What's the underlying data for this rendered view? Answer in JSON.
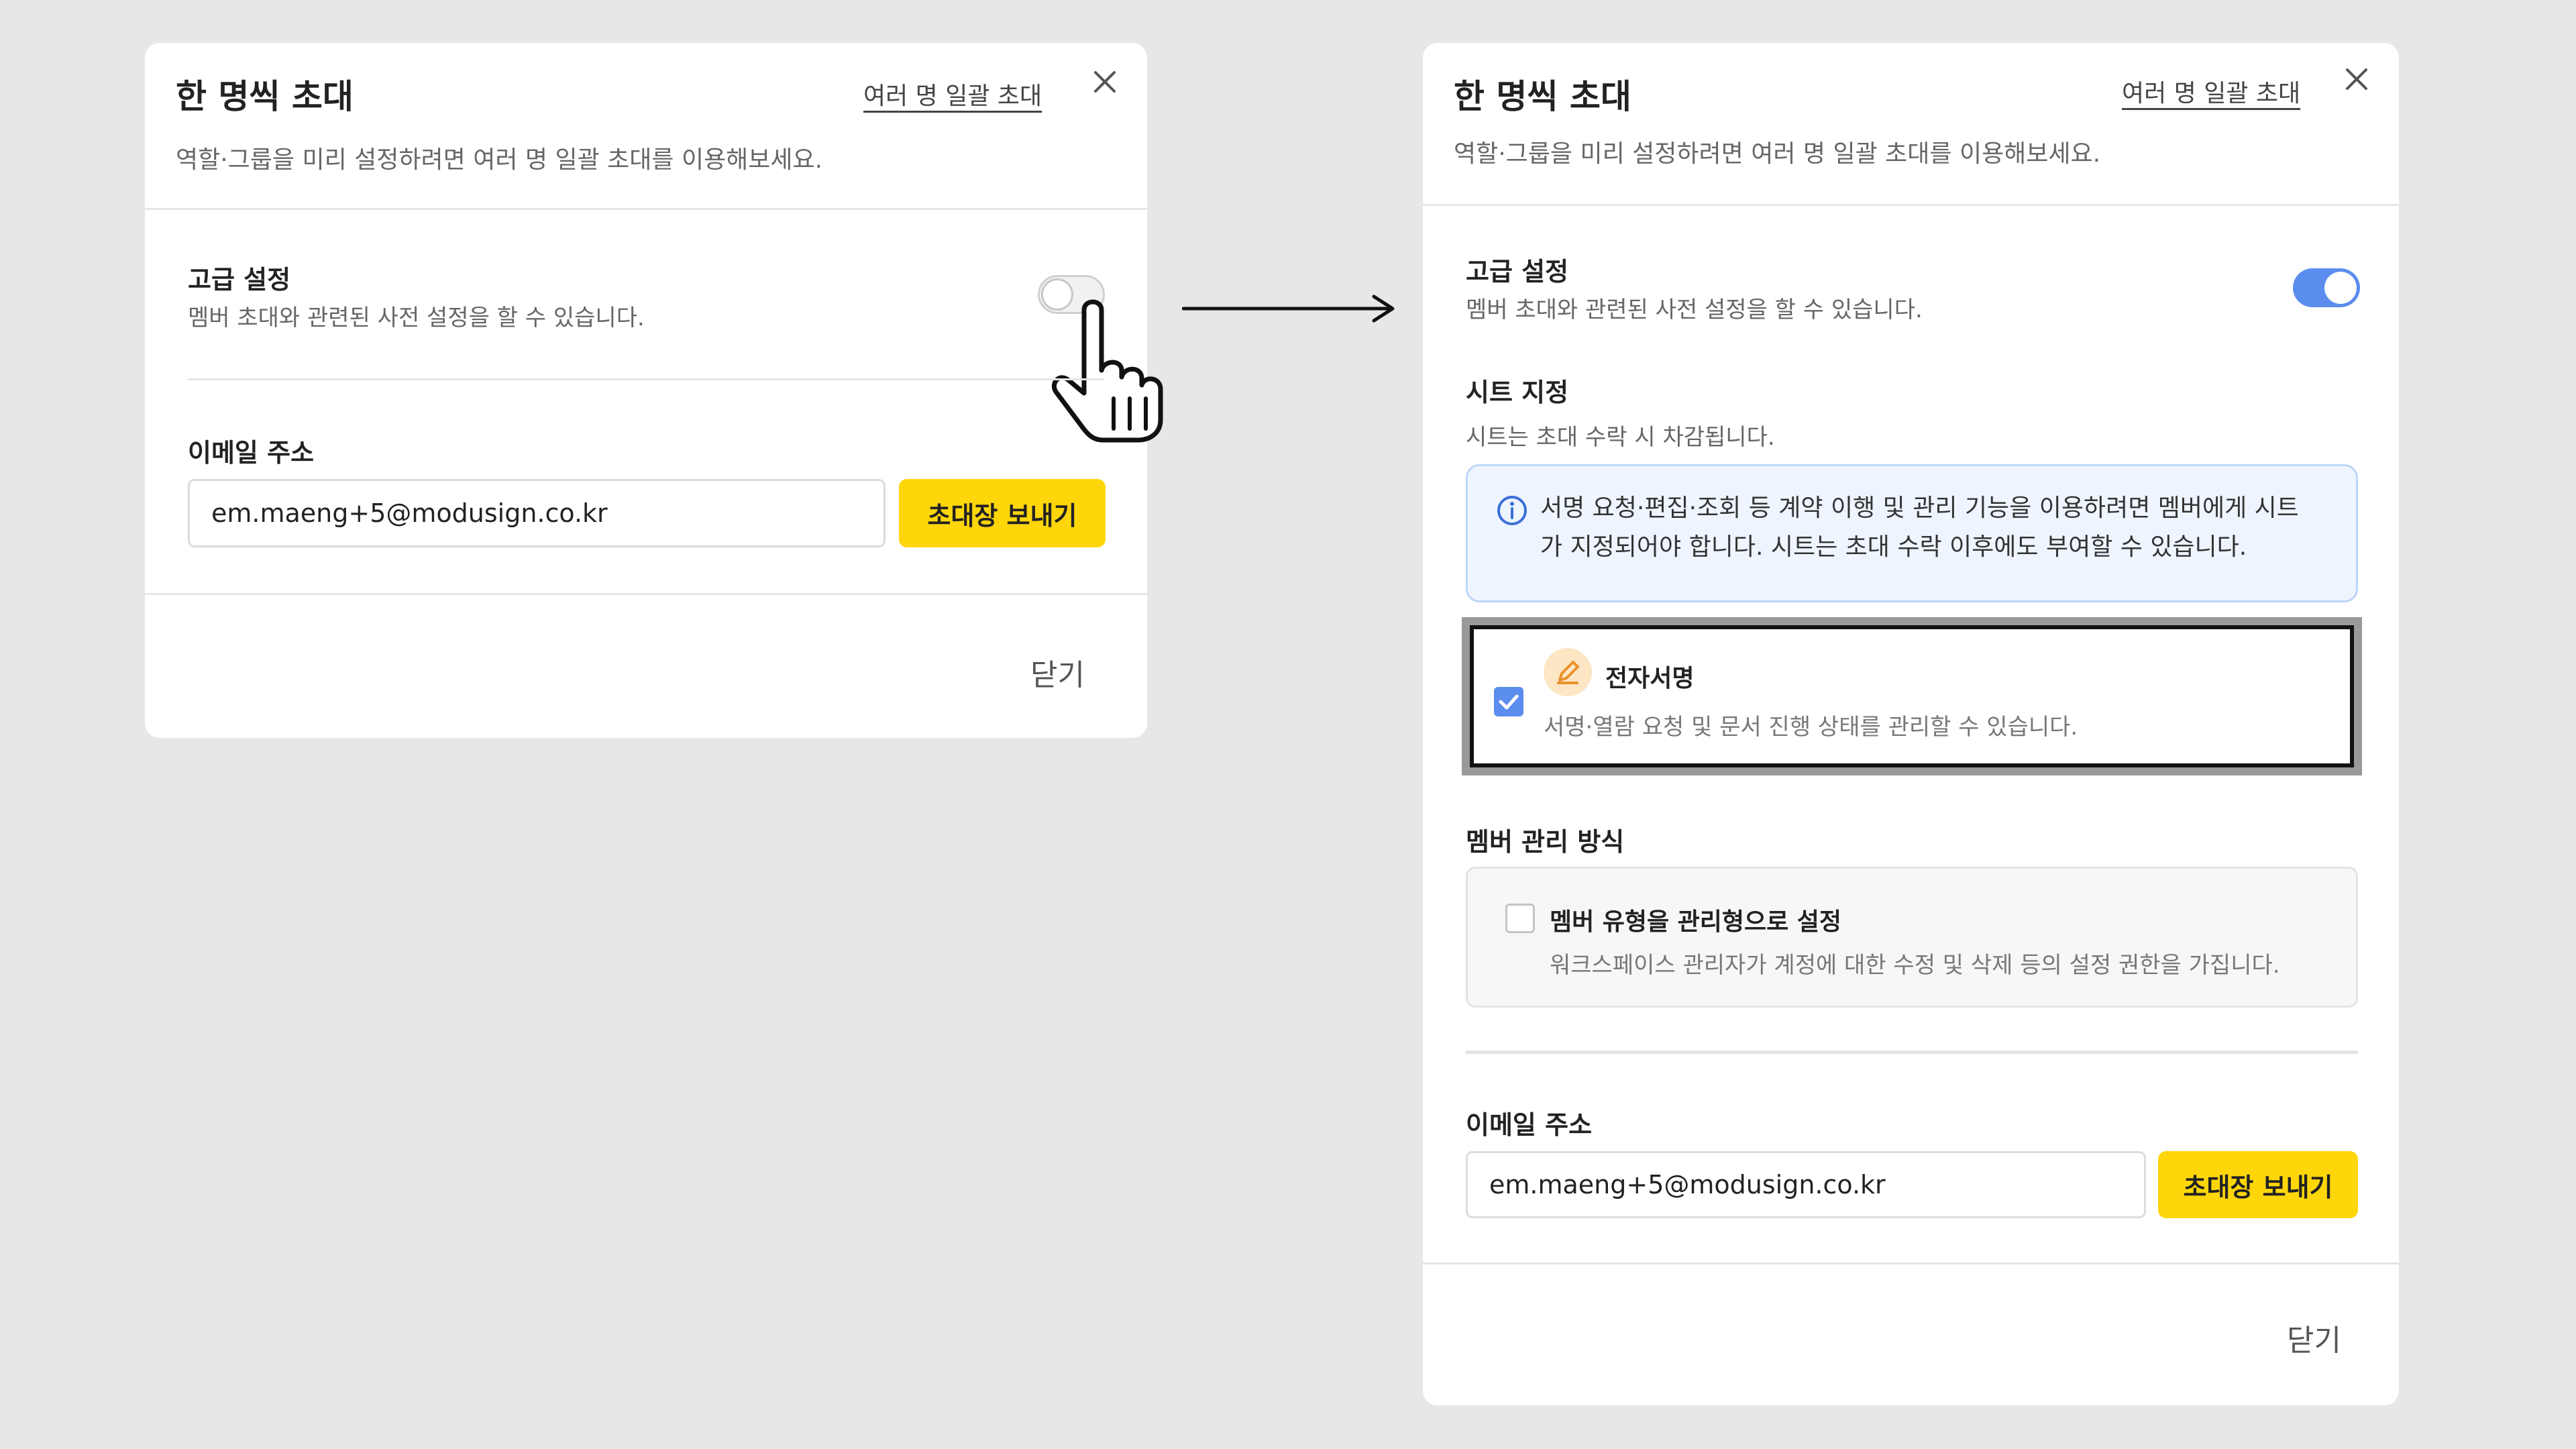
{
  "left_dialog": {
    "title": "한 명씩 초대",
    "bulk_invite_link": "여러 명 일괄 초대",
    "subtitle": "역할·그룹을 미리 설정하려면 여러 명 일괄 초대를 이용해보세요.",
    "advanced": {
      "label": "고급 설정",
      "description": "멤버 초대와 관련된 사전 설정을 할 수 있습니다.",
      "toggle_on": false
    },
    "email": {
      "label": "이메일 주소",
      "value": "em.maeng+5@modusign.co.kr"
    },
    "send_button": "초대장 보내기",
    "close_button": "닫기"
  },
  "right_dialog": {
    "title": "한 명씩 초대",
    "bulk_invite_link": "여러 명 일괄 초대",
    "subtitle": "역할·그룹을 미리 설정하려면 여러 명 일괄 초대를 이용해보세요.",
    "advanced": {
      "label": "고급 설정",
      "description": "멤버 초대와 관련된 사전 설정을 할 수 있습니다.",
      "toggle_on": true
    },
    "seat": {
      "label": "시트 지정",
      "description": "시트는 초대 수락 시 차감됩니다.",
      "info_line1": "서명 요청·편집·조회 등 계약 이행 및 관리 기능을 이용하려면 멤버에게 시트",
      "info_line2": "가 지정되어야 합니다. 시트는 초대 수락 이후에도 부여할 수 있습니다.",
      "option_title": "전자서명",
      "option_desc": "서명·열람 요청 및 문서 진행 상태를 관리할 수 있습니다.",
      "option_checked": true
    },
    "member_mgmt": {
      "label": "멤버 관리 방식",
      "option_title": "멤버 유형을 관리형으로 설정",
      "option_desc": "워크스페이스 관리자가 계정에 대한 수정 및 삭제 등의 설정 권한을 가집니다.",
      "option_checked": false
    },
    "email": {
      "label": "이메일 주소",
      "value": "em.maeng+5@modusign.co.kr"
    },
    "send_button": "초대장 보내기",
    "close_button": "닫기"
  },
  "colors": {
    "background": "#e7e7e7",
    "primary_yellow": "#ffd60a",
    "toggle_blue": "#5b8def",
    "info_bg": "#eef5ff",
    "info_icon": "#3b6fd8"
  },
  "icons": [
    "close-icon",
    "hand-pointer-icon",
    "arrow-right-icon",
    "info-icon",
    "pen-icon",
    "checkmark-icon"
  ]
}
